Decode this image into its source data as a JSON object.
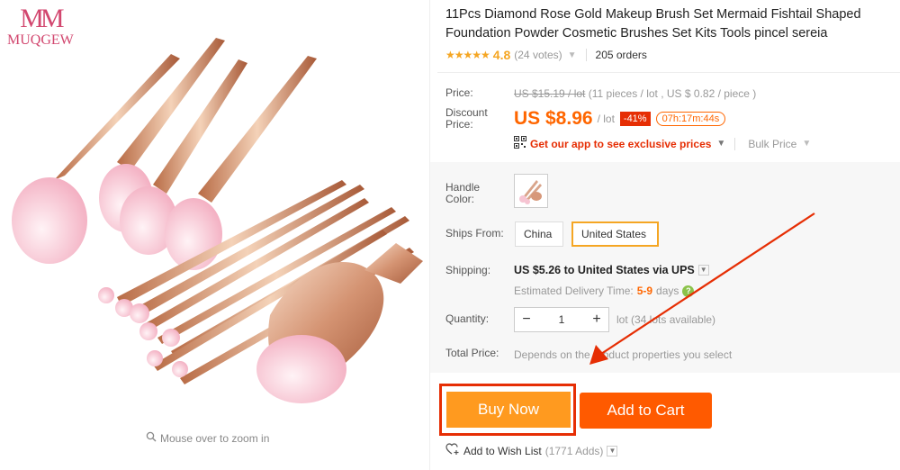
{
  "brand": {
    "mark": "MM",
    "name": "MUQGEW"
  },
  "gallery": {
    "zoom_hint": "Mouse over to zoom in"
  },
  "product": {
    "title": "11Pcs Diamond Rose Gold Makeup Brush Set Mermaid Fishtail Shaped Foundation Powder Cosmetic Brushes Set Kits Tools pincel sereia",
    "stars": "★★★★★",
    "rating": "4.8",
    "votes": "(24 votes)",
    "orders": "205 orders"
  },
  "pricing": {
    "price_label": "Price:",
    "old_price": "US $15.19 / lot",
    "old_price_note": "(11 pieces / lot , US $ 0.82 / piece )",
    "discount_label_1": "Discount",
    "discount_label_2": "Price:",
    "price": "US $8.96",
    "per_lot": "/ lot",
    "discount_badge": "-41%",
    "timer": "07h:17m:44s",
    "app_link": "Get our app to see exclusive prices",
    "bulk_price": "Bulk Price"
  },
  "options": {
    "handle_label_1": "Handle",
    "handle_label_2": "Color:",
    "ships_from_label": "Ships From:",
    "ships_from": [
      "China",
      "United States"
    ],
    "selected_ship": "United States",
    "shipping_label": "Shipping:",
    "shipping_value": "US $5.26 to United States via UPS",
    "eta_prefix": "Estimated Delivery Time:",
    "eta_days": "5-9",
    "eta_suffix": "days",
    "quantity_label": "Quantity:",
    "quantity": "1",
    "availability": "lot (34 lots available)",
    "total_label": "Total Price:",
    "total_note": "Depends on the product properties you select"
  },
  "actions": {
    "buy_now": "Buy Now",
    "add_to_cart": "Add to Cart",
    "wish_list": "Add to Wish List",
    "wish_count": "(1771 Adds)"
  },
  "colors": {
    "accent_orange": "#ff5a00",
    "buy_now_orange": "#ff9a1f",
    "highlight_red": "#e62e04",
    "star_gold": "#f5a623",
    "brand_pink": "#d2476f"
  }
}
